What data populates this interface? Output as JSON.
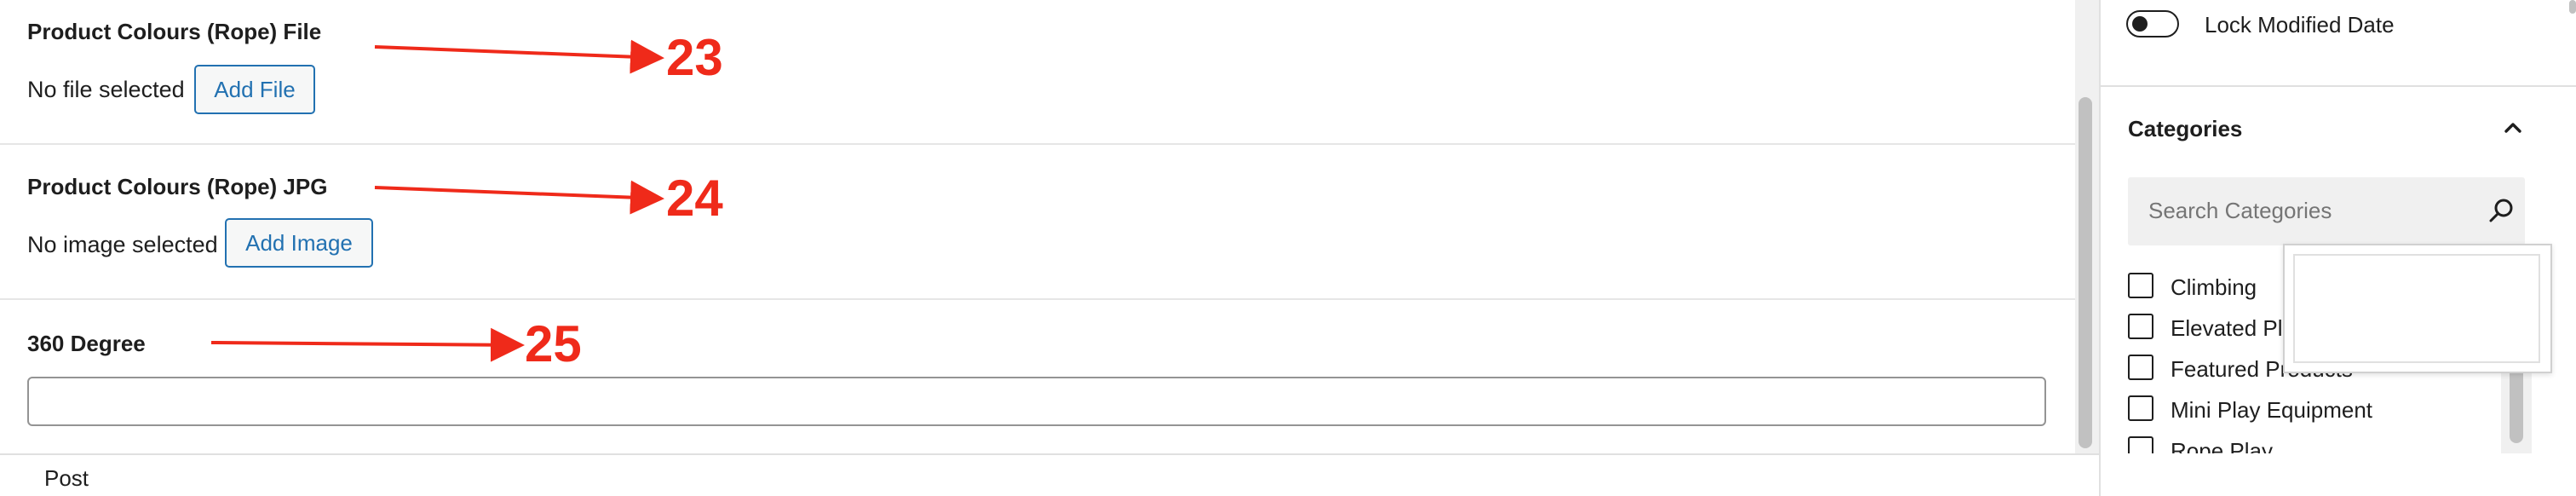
{
  "fields": [
    {
      "label": "Product Colours (Rope) File",
      "status": "No file selected",
      "button": "Add File",
      "annotation": "23"
    },
    {
      "label": "Product Colours (Rope) JPG",
      "status": "No image selected",
      "button": "Add Image",
      "annotation": "24"
    },
    {
      "label": "360 Degree",
      "value": "",
      "annotation": "25"
    }
  ],
  "sidebar": {
    "lock_label": "Lock Modified Date",
    "lock_enabled": false,
    "categories_title": "Categories",
    "search_placeholder": "Search Categories",
    "categories": [
      {
        "label": "Climbing",
        "checked": false
      },
      {
        "label": "Elevated Pla",
        "checked": false
      },
      {
        "label": "Featured Products",
        "checked": false
      },
      {
        "label": "Mini Play Equipment",
        "checked": false
      },
      {
        "label": "Rope Play",
        "checked": false
      }
    ]
  },
  "footer": {
    "label": "Post"
  },
  "colors": {
    "annotation": "#ef2a1a",
    "link": "#2271b1"
  },
  "icons": [
    "chevron-up-icon",
    "search-icon",
    "toggle-switch"
  ]
}
